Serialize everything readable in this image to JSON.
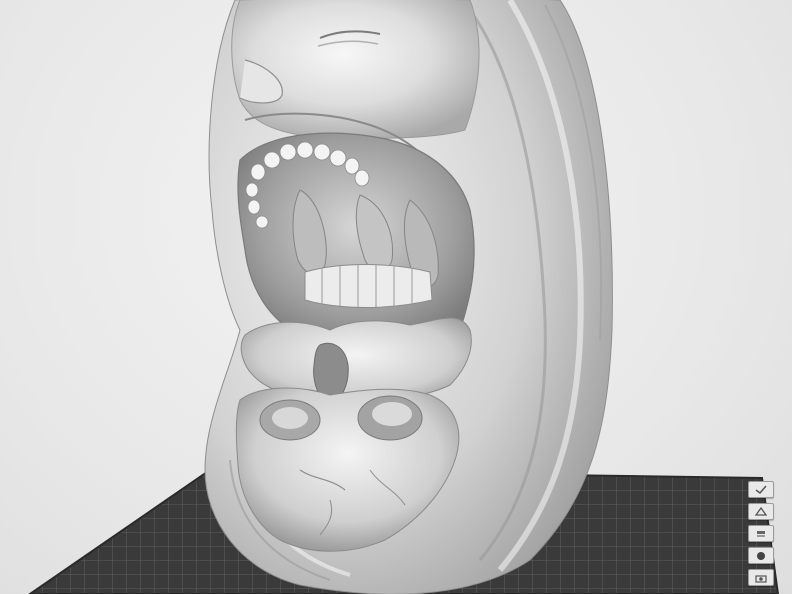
{
  "app": {
    "view": "3d-print-slicer-viewport"
  },
  "scene": {
    "model": "sculpture-face-skull-hood",
    "plate_label": "",
    "colors": {
      "background": "#e9e9e9",
      "plate": "#3a3a3a",
      "grid": "#6f6f6f",
      "model": "#d9d9d9"
    }
  },
  "side_tools": [
    {
      "name": "view-mode-icon"
    },
    {
      "name": "perspective-icon"
    },
    {
      "name": "layer-icon"
    },
    {
      "name": "shading-icon"
    },
    {
      "name": "camera-icon"
    }
  ]
}
